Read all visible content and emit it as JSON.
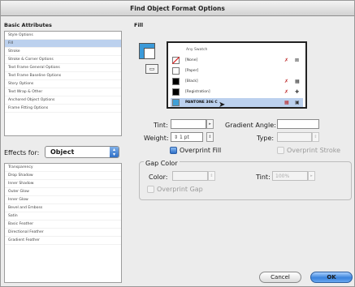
{
  "window": {
    "title": "Find Object Format Options"
  },
  "left": {
    "basic_heading": "Basic Attributes",
    "basic_items": [
      {
        "label": "Style Options",
        "selected": false
      },
      {
        "label": "Fill",
        "selected": true
      },
      {
        "label": "Stroke",
        "selected": false
      },
      {
        "label": "Stroke & Corner Options",
        "selected": false
      },
      {
        "label": "Text Frame General Options",
        "selected": false
      },
      {
        "label": "Text Frame Baseline Options",
        "selected": false
      },
      {
        "label": "Story Options",
        "selected": false
      },
      {
        "label": "Text Wrap & Other",
        "selected": false
      },
      {
        "label": "Anchored Object Options",
        "selected": false
      },
      {
        "label": "Frame Fitting Options",
        "selected": false
      }
    ],
    "effects_label": "Effects for:",
    "effects_value": "Object",
    "effects_items": [
      {
        "label": "Transparency"
      },
      {
        "label": "Drop Shadow"
      },
      {
        "label": "Inner Shadow"
      },
      {
        "label": "Outer Glow"
      },
      {
        "label": "Inner Glow"
      },
      {
        "label": "Bevel and Emboss"
      },
      {
        "label": "Satin"
      },
      {
        "label": "Basic Feather"
      },
      {
        "label": "Directional Feather"
      },
      {
        "label": "Gradient Feather"
      }
    ]
  },
  "fill": {
    "heading": "Fill",
    "swatch_color": "#3b9ad9",
    "swatches": {
      "header": "Any Swatch",
      "rows": [
        {
          "name": "[None]",
          "color": "#ffffff",
          "icon1": "✗",
          "icon2": "⊠",
          "selected": false
        },
        {
          "name": "[Paper]",
          "color": "#ffffff",
          "icon1": "",
          "icon2": "",
          "selected": false
        },
        {
          "name": "[Black]",
          "color": "#000000",
          "icon1": "✗",
          "icon2": "▦",
          "selected": false
        },
        {
          "name": "[Registration]",
          "color": "#000000",
          "icon1": "✗",
          "icon2": "✚",
          "selected": false
        },
        {
          "name": "PANTONE 306 C",
          "color": "#3fa0d8",
          "icon1": "▦",
          "icon2": "▣",
          "selected": true
        }
      ]
    },
    "tint_label": "Tint:",
    "tint_value": "",
    "gradient_angle_label": "Gradient Angle:",
    "gradient_angle_value": "",
    "weight_label": "Weight:",
    "weight_value": "1 pt",
    "type_label": "Type:",
    "type_value": "",
    "overprint_fill_label": "Overprint Fill",
    "overprint_stroke_label": "Overprint Stroke"
  },
  "gap": {
    "heading": "Gap Color",
    "color_label": "Color:",
    "color_value": "",
    "tint_label": "Tint:",
    "tint_value": "100%",
    "overprint_gap_label": "Overprint Gap"
  },
  "buttons": {
    "cancel": "Cancel",
    "ok": "OK"
  }
}
